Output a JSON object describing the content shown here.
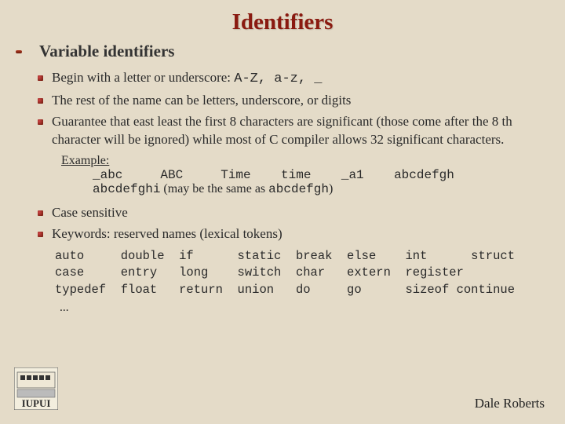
{
  "title": "Identifiers",
  "subtitle": "Variable identifiers",
  "bullets": {
    "b1_pre": "Begin with a letter or underscore: ",
    "b1_code": "A-Z, a-z, _",
    "b2": "The rest of the name can be letters, underscore, or digits",
    "b3": "Guarantee that east least the first 8 characters are significant (those come after the 8 th character will be ignored) while most of C compiler allows 32 significant characters.",
    "b4": "Case sensitive",
    "b5": "Keywords: reserved names (lexical tokens)"
  },
  "example": {
    "label": "Example:",
    "line1": "_abc     ABC     Time    time    _a1    abcdefgh",
    "line2_code1": "abcdefghi",
    "line2_mid": " (may be the same as ",
    "line2_code2": "abcdefgh",
    "line2_end": ")"
  },
  "kw": {
    "r1": "auto     double  if      static  break  else    int      struct",
    "r2": "case     entry   long    switch  char   extern  register",
    "r3": "typedef  float   return  union   do     go      sizeof continue",
    "dots": "..."
  },
  "author": "Dale Roberts"
}
